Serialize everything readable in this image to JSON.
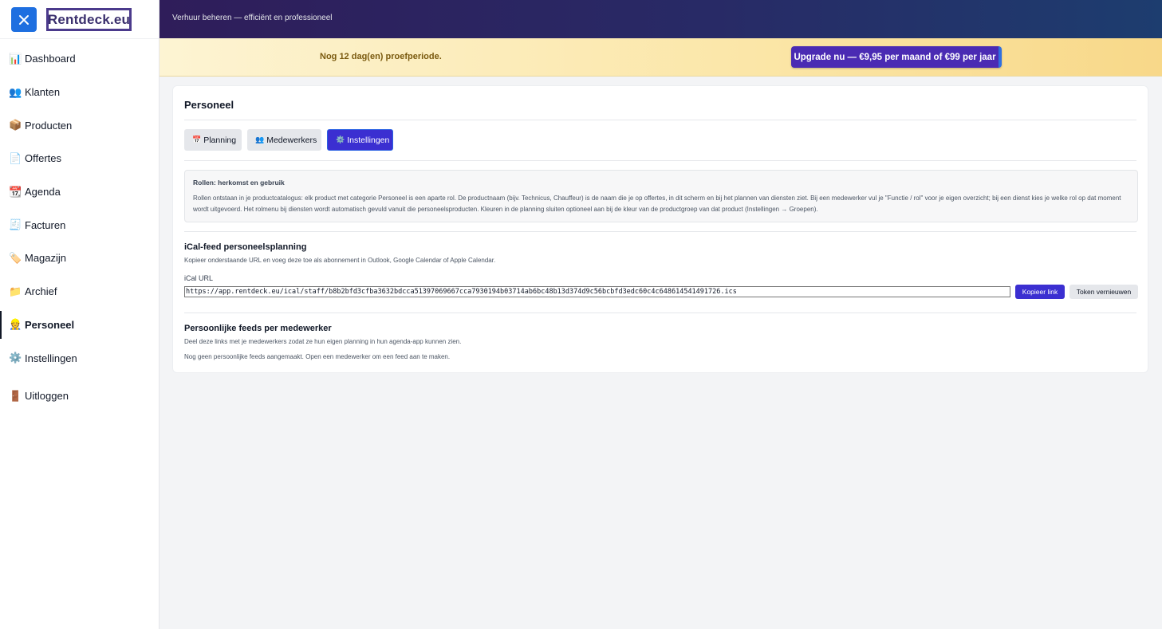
{
  "sidebar": {
    "logo_text": "Rentdeck.eu",
    "items": [
      {
        "icon": "📊",
        "label": "Dashboard"
      },
      {
        "icon": "👥",
        "label": "Klanten"
      },
      {
        "icon": "📦",
        "label": "Producten"
      },
      {
        "icon": "📄",
        "label": "Offertes"
      },
      {
        "icon": "📆",
        "label": "Agenda"
      },
      {
        "icon": "🧾",
        "label": "Facturen"
      },
      {
        "icon": "🏷️",
        "label": "Magazijn"
      },
      {
        "icon": "📁",
        "label": "Archief"
      },
      {
        "icon": "👷",
        "label": "Personeel"
      },
      {
        "icon": "⚙️",
        "label": "Instellingen"
      }
    ],
    "logout": {
      "icon": "🚪",
      "label": "Uitloggen"
    },
    "active_item": "Personeel"
  },
  "header": {
    "tagline": "Verhuur beheren — efficiënt en professioneel"
  },
  "trial": {
    "text": "Nog 12 dag(en) proefperiode.",
    "upgrade_label": "Upgrade nu — €9,95 per maand of €99 per jaar"
  },
  "main": {
    "title": "Personeel",
    "tabs": [
      {
        "icon": "📅",
        "label": "Planning"
      },
      {
        "icon": "👥",
        "label": "Medewerkers"
      },
      {
        "icon": "⚙️",
        "label": "Instellingen"
      }
    ],
    "active_tab": "Instellingen",
    "roles_box": {
      "title": "Rollen: herkomst en gebruik",
      "body": "Rollen ontstaan in je productcatalogus: elk product met categorie Personeel is een aparte rol. De productnaam (bijv. Technicus, Chauffeur) is de naam die je op offertes, in dit scherm en bij het plannen van diensten ziet. Bij een medewerker vul je \"Functie / rol\" voor je eigen overzicht; bij een dienst kies je welke rol op dat moment wordt uitgevoerd. Het rolmenu bij diensten wordt automatisch gevuld vanuit die personeelsproducten. Kleuren in de planning sluiten optioneel aan bij de kleur van de productgroep van dat product (Instellingen → Groepen)."
    },
    "ical": {
      "title": "iCal-feed personeelsplanning",
      "subtitle": "Kopieer onderstaande URL en voeg deze toe als abonnement in Outlook, Google Calendar of Apple Calendar.",
      "field_label": "iCal URL",
      "url": "https://app.rentdeck.eu/ical/staff/b8b2bfd3cfba3632bdcca51397069667cca7930194b03714ab6bc48b13d374d9c56bcbfd3edc60c4c648614541491726.ics",
      "copy_label": "Kopieer link",
      "renew_label": "Token vernieuwen"
    },
    "personal_feeds": {
      "title": "Persoonlijke feeds per medewerker",
      "subtitle": "Deel deze links met je medewerkers zodat ze hun eigen planning in hun agenda-app kunnen zien.",
      "empty_text": "Nog geen persoonlijke feeds aangemaakt. Open een medewerker om een feed aan te maken."
    }
  },
  "colors": {
    "accent": "#3b2fd1",
    "close_button": "#1e6fe0",
    "header_start": "#2f1d5a",
    "header_end": "#1d3d6f",
    "trial_text": "#7a5a0f"
  }
}
